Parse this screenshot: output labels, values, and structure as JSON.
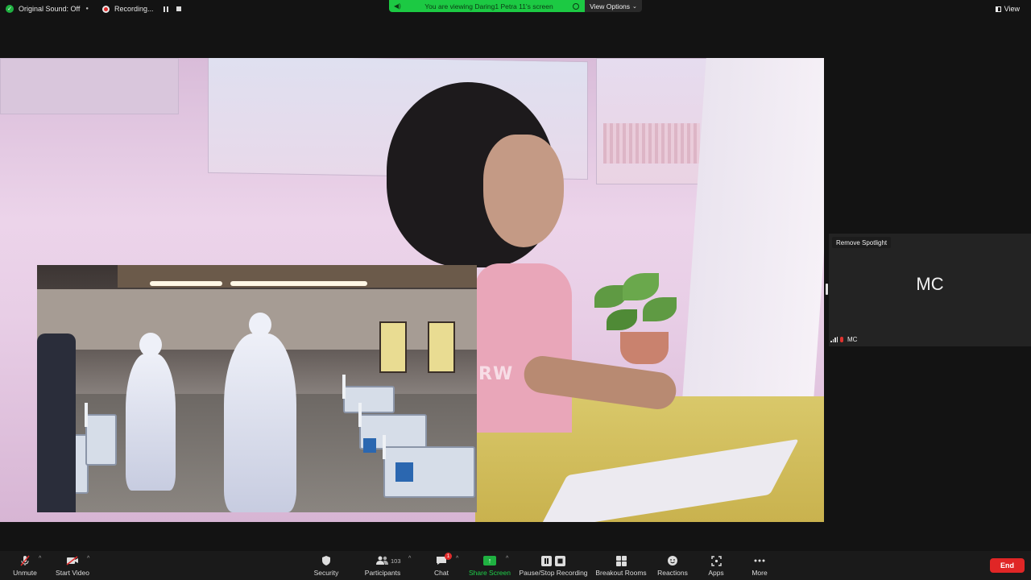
{
  "topbar": {
    "original_sound": "Original Sound: Off",
    "recording": "Recording...",
    "viewing_banner": "You are viewing Daring1 Petra 11's screen",
    "view_options": "View Options",
    "view": "View"
  },
  "shared_screen": {
    "shirt_text": "RW"
  },
  "spotlight": {
    "remove_spotlight": "Remove Spotlight",
    "initials": "MC",
    "participant_name": "MC"
  },
  "toolbar": {
    "unmute": "Unmute",
    "start_video": "Start Video",
    "security": "Security",
    "participants": "Participants",
    "participants_count": "103",
    "chat": "Chat",
    "chat_badge": "1",
    "share_screen": "Share Screen",
    "pause_stop_recording": "Pause/Stop Recording",
    "breakout_rooms": "Breakout Rooms",
    "reactions": "Reactions",
    "apps": "Apps",
    "more": "More",
    "end": "End"
  },
  "colors": {
    "share_green": "#1fb141",
    "end_red": "#e02626",
    "banner_green": "#1cc943"
  }
}
